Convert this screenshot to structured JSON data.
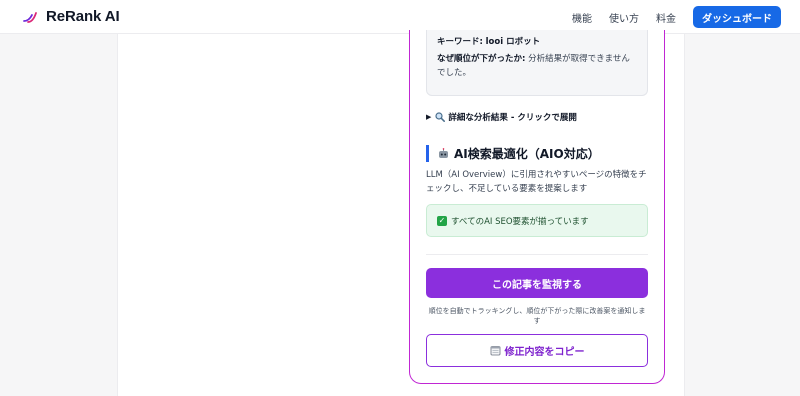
{
  "header": {
    "brand": "ReRank AI",
    "nav": [
      "機能",
      "使い方",
      "料金"
    ],
    "dashboard_label": "ダッシュボード"
  },
  "reason_box": {
    "keyword_label": "キーワード:",
    "keyword_value": "looi ロボット",
    "why_label": "なぜ順位が下がったか:",
    "why_value": "分析結果が取得できませんでした。"
  },
  "details": {
    "label": "詳細な分析結果 - クリックで展開"
  },
  "aio": {
    "title": "AI検索最適化（AIO対応）",
    "description": "LLM（AI Overview）に引用されやすいページの特徴をチェックし、不足している要素を提案します",
    "ok_message": "すべてのAI SEO要素が揃っています"
  },
  "actions": {
    "monitor_label": "この記事を監視する",
    "monitor_note": "順位を自動でトラッキングし、順位が下がった際に改善案を通知します",
    "copy_label": "修正内容をコピー"
  },
  "colors": {
    "primary_blue": "#1769e6",
    "purple": "#8b2fdd",
    "card_border": "#c026d3",
    "success_bg": "#e9f8ee"
  },
  "icons": {
    "brand": "rerank-logo-icon",
    "details": "magnifier-icon",
    "aio": "robot-icon",
    "ok": "check-icon",
    "copy": "memo-icon"
  }
}
